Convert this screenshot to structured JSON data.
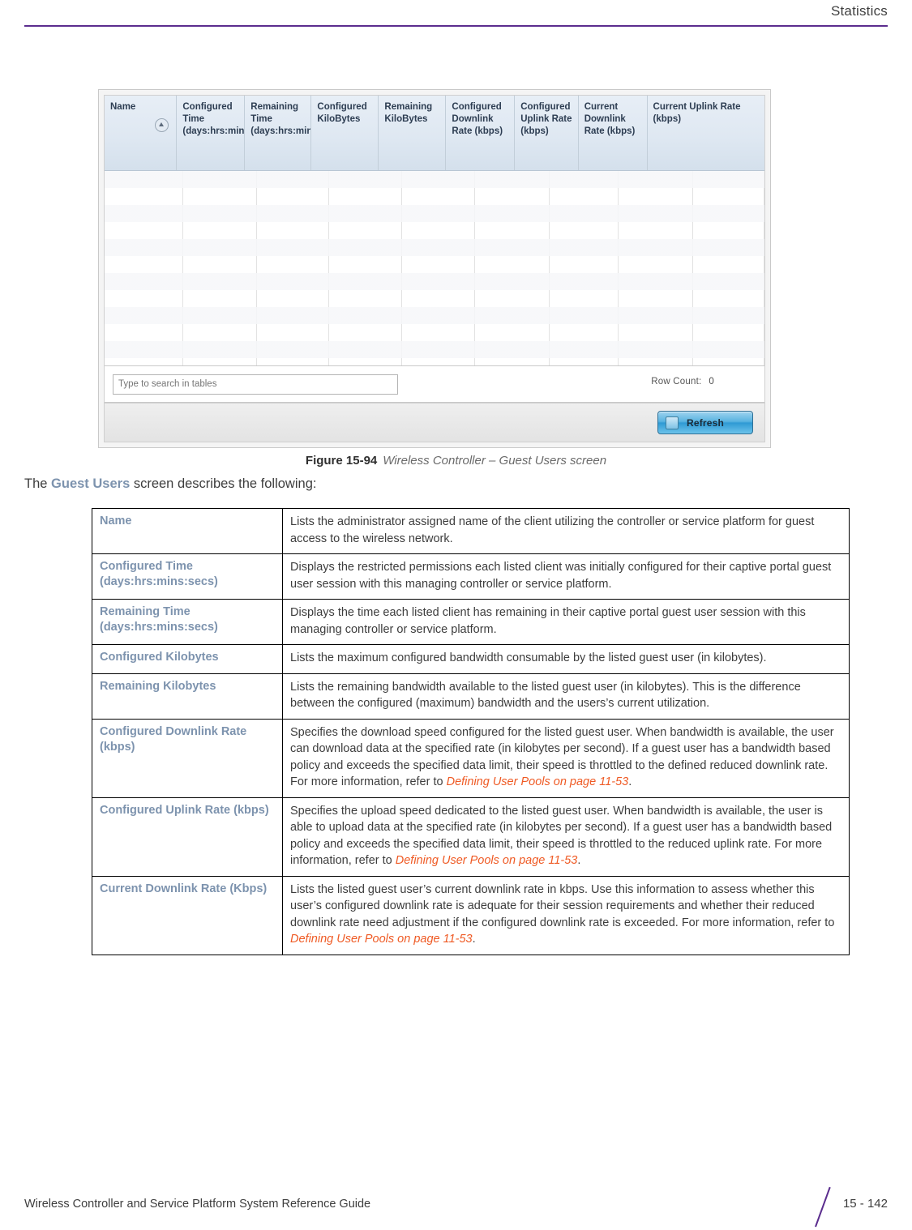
{
  "header": {
    "title": "Statistics"
  },
  "screenshot": {
    "grid": {
      "columns": [
        {
          "label": "Name",
          "sort_icon": "sort-ascending-icon"
        },
        {
          "label": "Configured Time (days:hrs:mins:secs)"
        },
        {
          "label": "Remaining Time (days:hrs:mins:secs)"
        },
        {
          "label": "Configured KiloBytes"
        },
        {
          "label": "Remaining KiloBytes"
        },
        {
          "label": "Configured Downlink Rate (kbps)"
        },
        {
          "label": "Configured Uplink Rate (kbps)"
        },
        {
          "label": "Current Downlink Rate (kbps)"
        },
        {
          "label": "Current Uplink Rate (kbps)"
        }
      ],
      "rows": []
    },
    "search_placeholder": "Type to search in tables",
    "search_value": "",
    "row_count_label": "Row Count:",
    "row_count_value": "0",
    "refresh_label": "Refresh"
  },
  "figure": {
    "number": "Figure 15-94",
    "caption": "Wireless Controller – Guest Users screen"
  },
  "intro": {
    "before": "The ",
    "highlight": "Guest Users",
    "after": " screen describes the following:"
  },
  "descriptions": [
    {
      "term": "Name",
      "text": "Lists the administrator assigned name of the client utilizing the controller or service platform for guest access to the wireless network.",
      "xref": ""
    },
    {
      "term": "Configured Time (days:hrs:mins:secs)",
      "text": "Displays the restricted permissions each listed client was initially configured for their captive portal guest user session with this managing controller or service platform.",
      "xref": ""
    },
    {
      "term": "Remaining Time (days:hrs:mins:secs)",
      "text": "Displays the time each listed client has remaining in their captive portal guest user session with this managing controller or service platform.",
      "xref": ""
    },
    {
      "term": "Configured Kilobytes",
      "text": "Lists the maximum configured bandwidth consumable by the listed guest user (in kilobytes).",
      "xref": ""
    },
    {
      "term": "Remaining Kilobytes",
      "text": "Lists the remaining bandwidth available to the listed guest user (in kilobytes). This is the difference between the configured (maximum) bandwidth and the users’s current utilization.",
      "xref": ""
    },
    {
      "term": "Configured Downlink Rate (kbps)",
      "text": "Specifies the download speed configured for the listed guest user. When bandwidth is available, the user can download data at the specified rate (in kilobytes per second). If a guest user has a bandwidth based policy and exceeds the specified data limit, their speed is throttled to the defined reduced downlink rate. For more information, refer to ",
      "xref": "Defining User Pools on page 11-53",
      "after": "."
    },
    {
      "term": "Configured Uplink Rate (kbps)",
      "text": "Specifies the upload speed dedicated to the listed guest user. When bandwidth is available, the user is able to upload data at the specified rate (in kilobytes per second). If a guest user has a bandwidth based policy and exceeds the specified data limit, their speed is throttled to the reduced uplink rate. For more information, refer to ",
      "xref": "Defining User Pools on page 11-53",
      "after": "."
    },
    {
      "term": "Current Downlink Rate (Kbps)",
      "text": "Lists the listed guest user’s current downlink rate in kbps. Use this information to assess whether this user’s configured downlink rate is adequate for their session requirements and whether their reduced downlink rate need adjustment if the configured downlink rate is exceeded. For more information, refer to ",
      "xref": "Defining User Pools on page 11-53",
      "after": "."
    }
  ],
  "footer": {
    "guide": "Wireless Controller and Service Platform System Reference Guide",
    "page": "15 - 142"
  },
  "colors": {
    "rule": "#5B2D8E",
    "term": "#7D93AE",
    "xref": "#EF5A24"
  }
}
